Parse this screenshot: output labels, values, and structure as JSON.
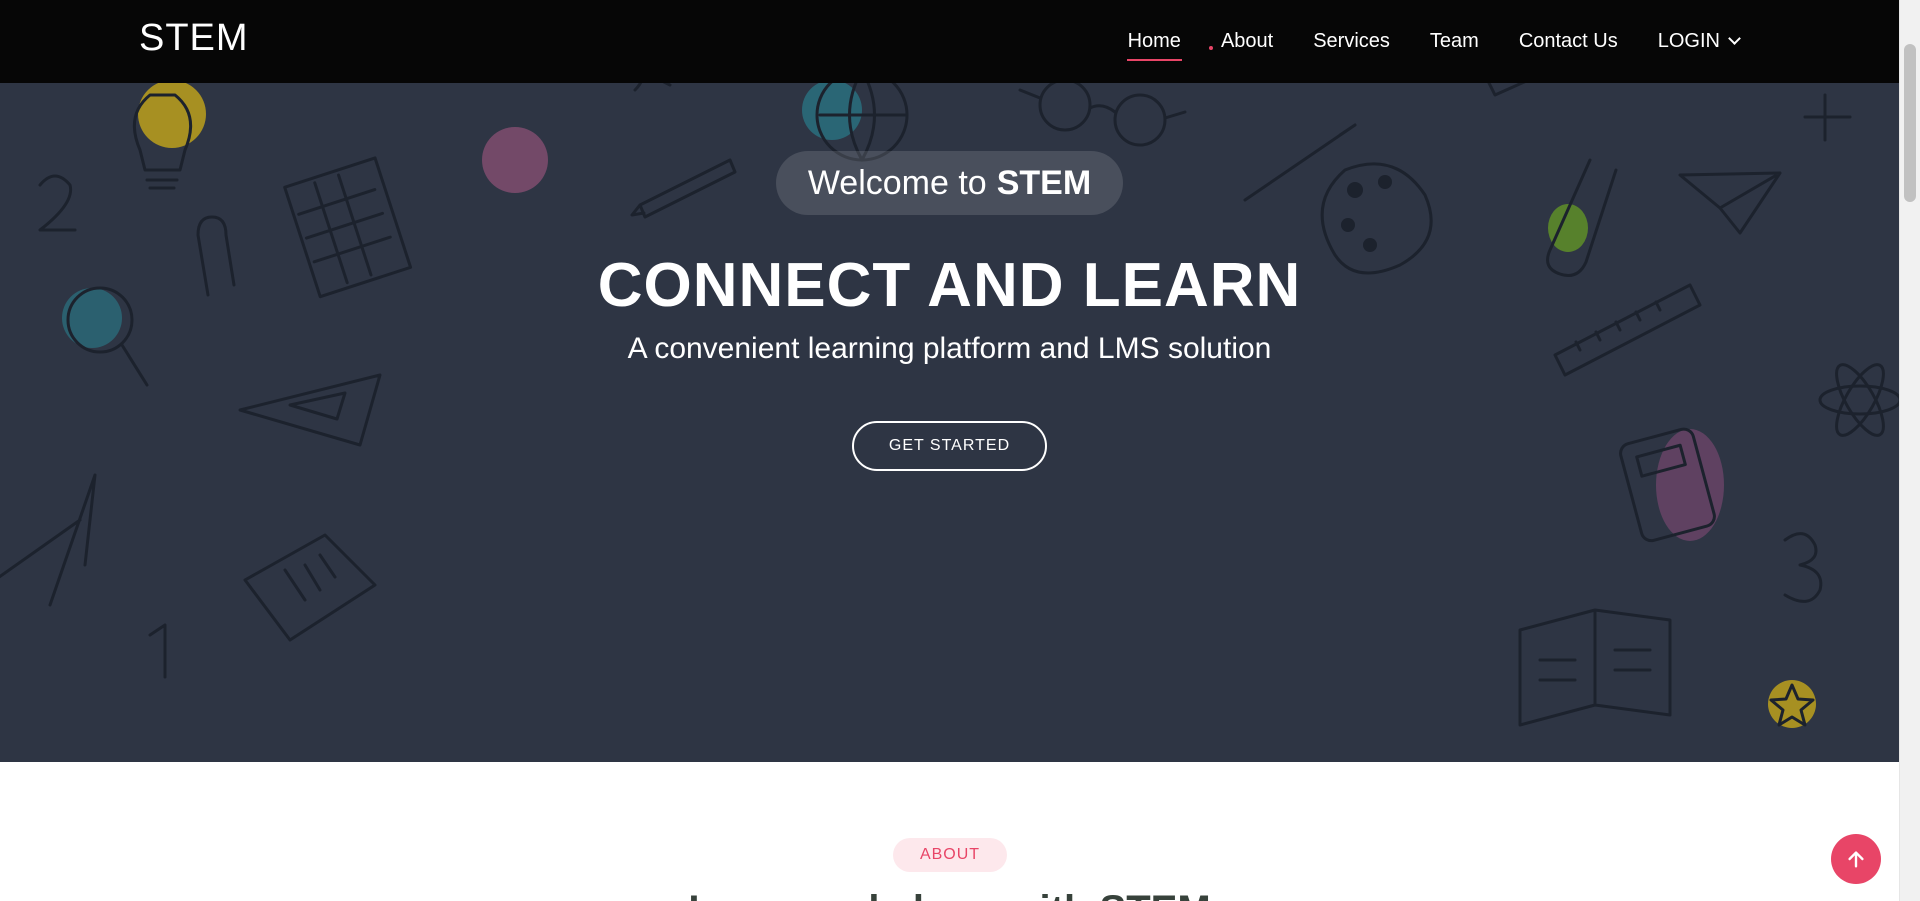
{
  "header": {
    "logo": "STEM",
    "nav": [
      {
        "label": "Home",
        "active": true
      },
      {
        "label": "About",
        "active": false
      },
      {
        "label": "Services",
        "active": false
      },
      {
        "label": "Team",
        "active": false
      },
      {
        "label": "Contact Us",
        "active": false
      },
      {
        "label": "LOGIN",
        "active": false,
        "dropdown": true
      }
    ]
  },
  "hero": {
    "welcome_prefix": "Welcome to",
    "welcome_brand": "STEM",
    "title": "CONNECT AND LEARN",
    "subtitle": "A convenient learning platform and LMS solution",
    "cta_label": "GET STARTED"
  },
  "about": {
    "badge": "ABOUT",
    "heading": "Learn and share with STEM"
  },
  "icons": {
    "back_to_top": "arrow-up-icon",
    "login_caret": "chevron-down-icon"
  },
  "colors": {
    "header_bg": "#060606",
    "hero_bg": "#2e3544",
    "accent": "#e84567",
    "doodle_stroke": "#1c222d"
  }
}
